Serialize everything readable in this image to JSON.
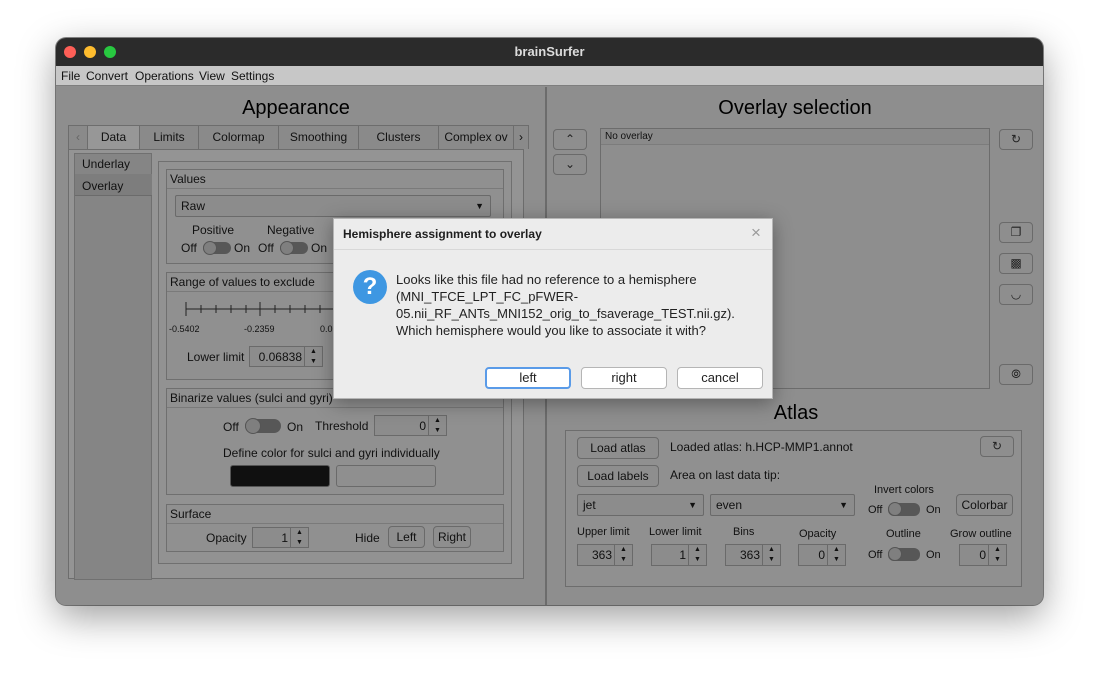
{
  "window": {
    "title": "brainSurfer"
  },
  "menu": [
    "File",
    "Convert",
    "Operations",
    "View",
    "Settings"
  ],
  "left": {
    "heading": "Appearance",
    "tabs": [
      "Data",
      "Limits",
      "Colormap",
      "Smoothing",
      "Clusters",
      "Complex ov"
    ],
    "side_items": [
      "Underlay",
      "Overlay"
    ],
    "values": {
      "title": "Values",
      "dropdown": "Raw",
      "positive_label": "Positive",
      "negative_label": "Negative",
      "off": "Off",
      "on": "On"
    },
    "range": {
      "title": "Range of values to exclude",
      "ticks": [
        "-0.5402",
        "-0.2359",
        "0.0"
      ],
      "lower_label": "Lower limit",
      "lower_value": "0.06838"
    },
    "binarize": {
      "title": "Binarize values (sulci and gyri)",
      "off": "Off",
      "on": "On",
      "threshold_label": "Threshold",
      "threshold_value": "0",
      "define_color": "Define color for sulci and gyri individually",
      "color_dark": "#101010",
      "color_light": "#8f8f8f"
    },
    "surface": {
      "title": "Surface",
      "opacity_label": "Opacity",
      "opacity_value": "1",
      "hide_label": "Hide",
      "left_btn": "Left",
      "right_btn": "Right"
    }
  },
  "right": {
    "heading": "Overlay selection",
    "list_item": "No overlay",
    "atlas_heading": "Atlas",
    "load_atlas": "Load atlas",
    "loaded_atlas": "Loaded atlas: h.HCP-MMP1.annot",
    "load_labels": "Load labels",
    "area_tip": "Area on last data tip:",
    "cmap": "jet",
    "spacing": "even",
    "invert_colors": "Invert colors",
    "off": "Off",
    "on": "On",
    "colorbar_btn": "Colorbar",
    "upper_label": "Upper limit",
    "upper_value": "363",
    "lower_label": "Lower limit",
    "lower_value": "1",
    "bins_label": "Bins",
    "bins_value": "363",
    "opacity_label": "Opacity",
    "opacity_value": "0",
    "outline_label": "Outline",
    "grow_label": "Grow outline",
    "grow_value": "0"
  },
  "dialog": {
    "title": "Hemisphere assignment to overlay",
    "lines": [
      "Looks like this file had no reference to a hemisphere",
      "(MNI_TFCE_LPT_FC_pFWER-",
      "05.nii_RF_ANTs_MNI152_orig_to_fsaverage_TEST.nii.gz).",
      "Which hemisphere would you like to associate it with?"
    ],
    "buttons": {
      "left": "left",
      "right": "right",
      "cancel": "cancel"
    }
  }
}
